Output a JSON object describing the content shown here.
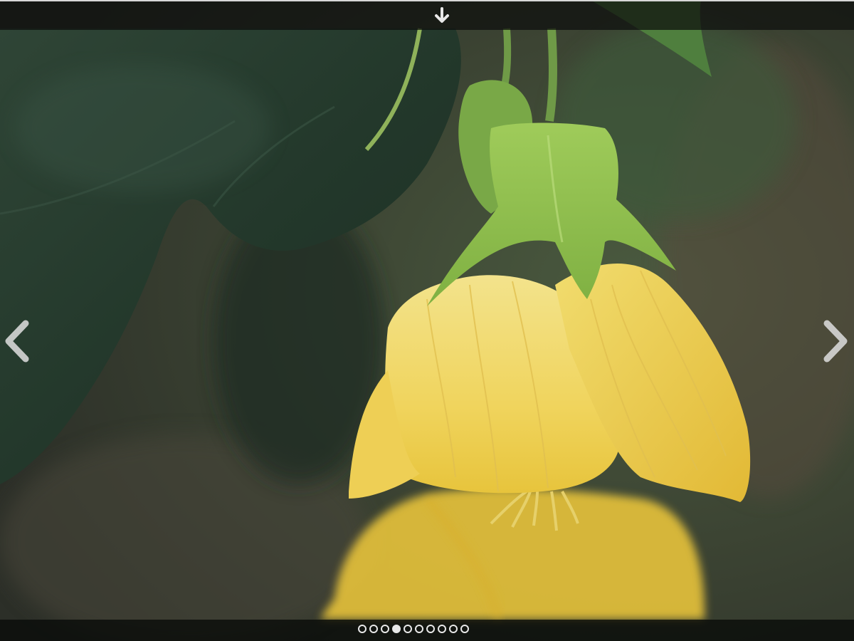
{
  "viewer": {
    "icons": {
      "download": "arrow-down-icon",
      "prev": "chevron-left-icon",
      "next": "chevron-right-icon"
    },
    "slides": {
      "count": 10,
      "active_index": 3
    },
    "colors": {
      "bar": "#0c0e0c",
      "control": "#e8e8e8"
    }
  }
}
